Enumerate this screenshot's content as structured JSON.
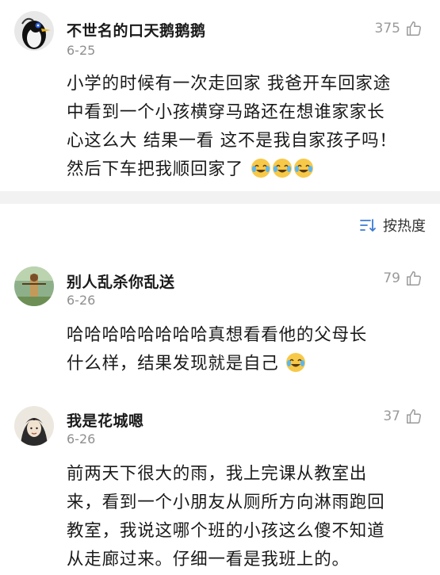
{
  "comments": [
    {
      "author": "不世名的口天鹅鹅鹅",
      "date": "6-25",
      "likes": "375",
      "text_lines": [
        "小学的时候有一次走回家 我爸开车回家途",
        "中看到一个小孩横穿马路还在想谁家家长",
        "心这么大 结果一看 这不是我自家孩子吗！",
        "然后下车把我顺回家了"
      ],
      "avatar_icon": "penguin-avatar-icon",
      "emoji_icon": "laugh-cry-emoji-icon"
    },
    {
      "author": "别人乱杀你乱送",
      "date": "6-26",
      "likes": "79",
      "text_lines": [
        "哈哈哈哈哈哈哈哈真想看看他的父母长",
        "什么样，结果发现就是自己"
      ],
      "avatar_icon": "scene-avatar-icon",
      "emoji_icon": "laugh-cry-emoji-icon"
    },
    {
      "author": "我是花城嗯",
      "date": "6-26",
      "likes": "37",
      "text_lines": [
        "前两天下很大的雨，我上完课从教室出",
        "来，看到一个小朋友从厕所方向淋雨跑回",
        "教室，我说这哪个班的小孩这么傻不知道",
        "从走廊过来。仔细一看是我班上的。"
      ],
      "avatar_icon": "portrait-avatar-icon"
    }
  ],
  "sort": {
    "label": "按热度",
    "icon": "sort-icon"
  },
  "colors": {
    "text": "#1a1a1a",
    "meta": "#8f8f8f",
    "divider_bar": "#f2f2f2"
  }
}
